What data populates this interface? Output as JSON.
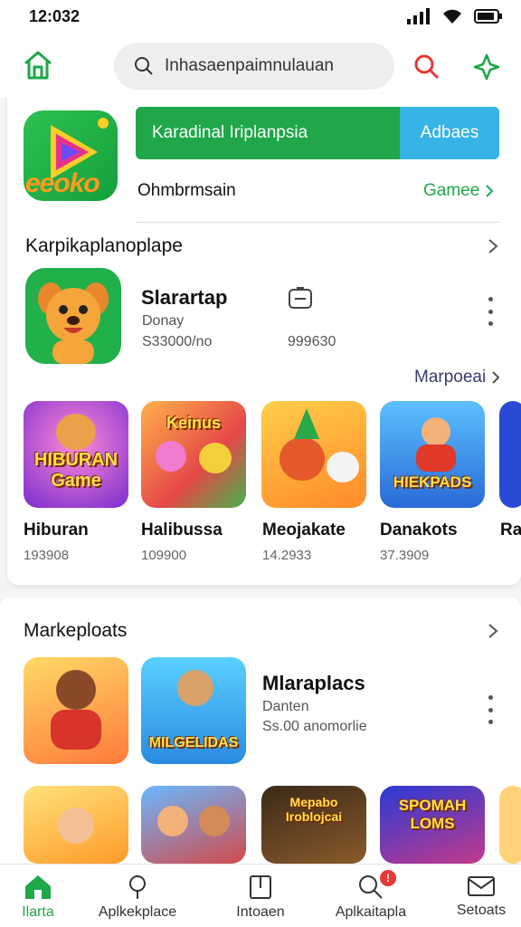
{
  "status_bar": {
    "time": "12:032"
  },
  "search": {
    "placeholder": "Inhasaenpaimnulauan"
  },
  "promo": {
    "logo_text": "eeoko",
    "title": "Karadinal Iriplanpsia",
    "action": "Adbaes",
    "subtitle": "Ohmbrmsain",
    "games_link": "Gamee"
  },
  "section1": {
    "title": "Karpikaplanoplape",
    "featured": {
      "name": "Slarartap",
      "sub": "Donay",
      "count": "S33000/no",
      "size": "999630"
    },
    "more_link": "Marpoeai",
    "games": [
      {
        "name": "Hiburan",
        "count": "193908",
        "art_text": "HIBURAN Game"
      },
      {
        "name": "Halibussa",
        "count": "109900",
        "art_text": "Keinus"
      },
      {
        "name": "Meojakate",
        "count": "14.2933",
        "art_text": ""
      },
      {
        "name": "Danakots",
        "count": "37.3909",
        "art_text": "HIEKPADS"
      },
      {
        "name": "Ra",
        "count": "",
        "art_text": ""
      }
    ]
  },
  "section2": {
    "title": "Markeploats",
    "app": {
      "name": "Mlaraplacs",
      "sub": "Danten",
      "count": "Ss.00 anomorlie"
    },
    "tiles": [
      {
        "art_text": ""
      },
      {
        "art_text": "MILGELIDAS"
      },
      {
        "art_text": ""
      },
      {
        "art_text": ""
      },
      {
        "art_text": "Mepabo Iroblojcai"
      },
      {
        "art_text": "SPOMAH LOMS"
      },
      {
        "art_text": ""
      }
    ]
  },
  "bottom_nav": [
    {
      "label": "Ilarta"
    },
    {
      "label": "Aplkekplace"
    },
    {
      "label": "Intoaen"
    },
    {
      "label": "Aplkaitapla",
      "badge": "!"
    },
    {
      "label": "Setoats"
    }
  ],
  "colors": {
    "brand_green": "#1fa74a",
    "accent_blue": "#37b3e6",
    "badge_red": "#e53935"
  }
}
